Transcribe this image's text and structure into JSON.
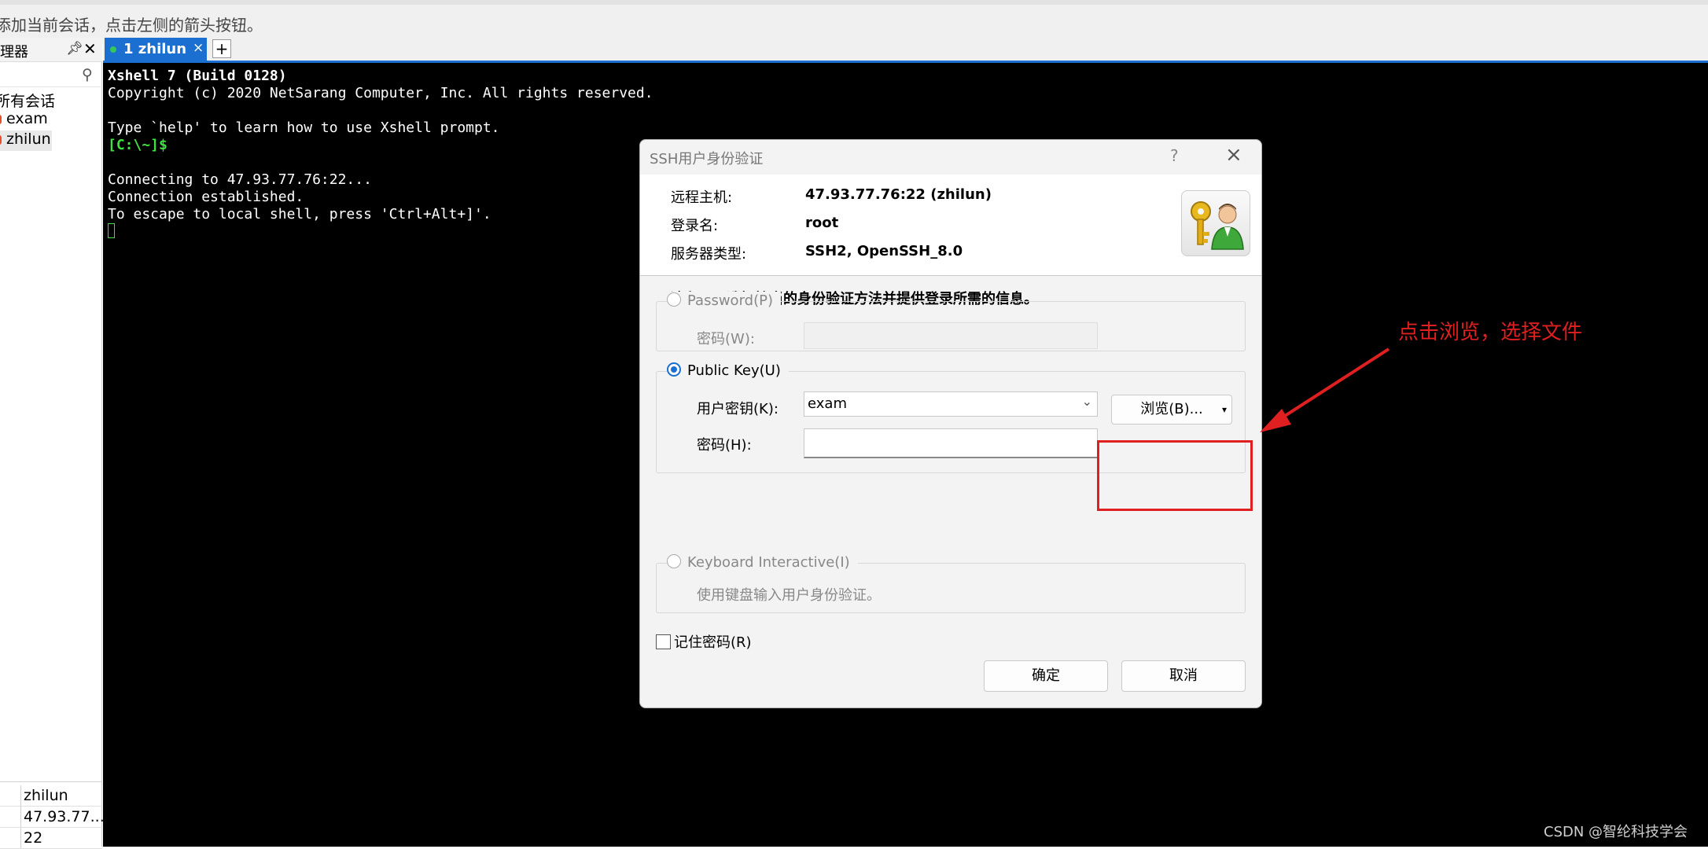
{
  "hint_bar": {
    "text": "添加当前会话，点击左侧的箭头按钮。"
  },
  "session_manager": {
    "title": "理器",
    "pin_icon": "pin-icon",
    "close_icon": "close-icon",
    "search_icon": "search-icon",
    "tree": {
      "root": "所有会话",
      "items": [
        "exam",
        "zhilun"
      ]
    },
    "properties": [
      "zhilun",
      "47.93.77....",
      "22"
    ]
  },
  "tabs": {
    "active": {
      "label": "1 zhilun",
      "close": "×"
    },
    "add_label": "+"
  },
  "terminal": {
    "lines": [
      "Xshell 7 (Build 0128)",
      "Copyright (c) 2020 NetSarang Computer, Inc. All rights reserved.",
      "",
      "Type `help' to learn how to use Xshell prompt.",
      "[C:\\~]$",
      "",
      "Connecting to 47.93.77.76:22...",
      "Connection established.",
      "To escape to local shell, press 'Ctrl+Alt+]'."
    ]
  },
  "dialog": {
    "title": "SSH用户身份验证",
    "help": "?",
    "close": "×",
    "info": {
      "host_label": "远程主机:",
      "host_value": "47.93.77.76:22 (zhilun)",
      "login_label": "登录名:",
      "login_value": "root",
      "server_label": "服务器类型:",
      "server_value": "SSH2, OpenSSH_8.0"
    },
    "instruction": "请在下面选择恰当的身份验证方法并提供登录所需的信息。",
    "password": {
      "label": "Password(P)",
      "field_label": "密码(W):",
      "value": ""
    },
    "public_key": {
      "label": "Public Key(U)",
      "user_key_label": "用户密钥(K):",
      "user_key_value": "exam",
      "passphrase_label": "密码(H):",
      "passphrase_value": "",
      "browse_label": "浏览(B)..."
    },
    "keyboard": {
      "label": "Keyboard Interactive(I)",
      "desc": "使用键盘输入用户身份验证。"
    },
    "remember_label": "记住密码(R)",
    "ok_label": "确定",
    "cancel_label": "取消"
  },
  "annotation": {
    "text": "点击浏览，选择文件",
    "color": "#e02020"
  },
  "watermark": "CSDN @智纶科技学会"
}
